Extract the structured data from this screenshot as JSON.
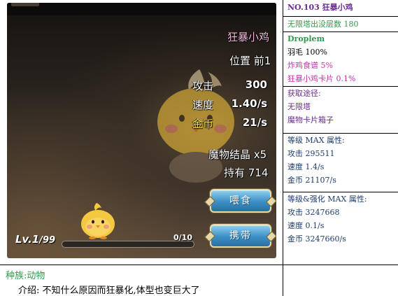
{
  "game": {
    "monster_name": "狂暴小鸡",
    "position_label": "位置 前1",
    "stats": [
      {
        "label": "攻击",
        "value": "300"
      },
      {
        "label": "速度",
        "value": "1.40/s"
      },
      {
        "label": "金币",
        "value": "21/s"
      }
    ],
    "crystal_label": "魔物结晶 x5",
    "held_label": "持有 714",
    "feed_button": "喂食",
    "carry_button": "携带",
    "level_text": "Lv.1",
    "level_max": "/99",
    "exp_text": "0/10",
    "exp_progress": 0
  },
  "info": {
    "title": "NO.103 狂暴小鸡",
    "floor": "无限塔出没层数 180",
    "drop_header": "Droplem",
    "drops": [
      "羽毛 100%",
      "炸鸡食谱 5%",
      "狂暴小鸡卡片 0.1%"
    ],
    "obtain_header": "获取途径:",
    "obtain": [
      "无限塔",
      "魔物卡片箱子"
    ],
    "maxlv_header": "等级 MAX 属性:",
    "maxlv": [
      "攻击 295511",
      "速度 1.4/s",
      "金币 21107/s"
    ],
    "maxall_header": "等级&强化 MAX 属性:",
    "maxall": [
      "攻击 3247668",
      "速度 0.1/s",
      "金币 3247660/s"
    ]
  },
  "bottom": {
    "race": "种族:动物",
    "desc": "介绍: 不知什么原因而狂暴化,体型也变巨大了"
  },
  "icons": [
    "big-chick-icon",
    "small-chick-icon"
  ],
  "colors": {
    "title": "#6b2c8f",
    "green": "#2f9a4a",
    "magenta": "#c42faa",
    "navy": "#1d3b6b",
    "button": "#3b8fc4"
  }
}
